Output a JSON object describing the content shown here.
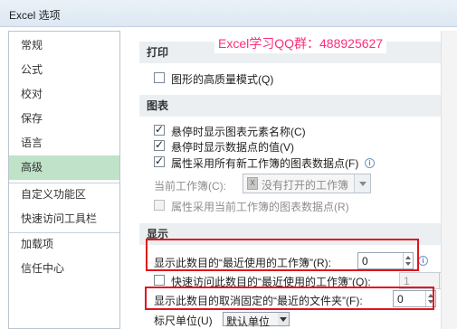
{
  "window": {
    "title": "Excel 选项"
  },
  "watermark": "Excel学习QQ群：488925627",
  "sidebar": {
    "items": [
      {
        "label": "常规"
      },
      {
        "label": "公式"
      },
      {
        "label": "校对"
      },
      {
        "label": "保存"
      },
      {
        "label": "语言"
      },
      {
        "label": "高级",
        "active": true
      },
      {
        "label": "自定义功能区"
      },
      {
        "label": "快速访问工具栏"
      },
      {
        "label": "加载项"
      },
      {
        "label": "信任中心"
      }
    ]
  },
  "sections": {
    "print": {
      "header": "打印",
      "high_quality_graphics": {
        "label": "图形的高质量模式(Q)",
        "checked": false
      }
    },
    "chart": {
      "header": "图表",
      "show_element_names": {
        "label": "悬停时显示图表元素名称(C)",
        "checked": true
      },
      "show_data_values": {
        "label": "悬停时显示数据点的值(V)",
        "checked": true
      },
      "props_follow_all": {
        "label": "属性采用所有新工作簿的图表数据点(F)",
        "checked": true
      },
      "current_workbook_label": "当前工作簿(C):",
      "current_workbook_value": "没有打开的工作簿",
      "props_follow_current": {
        "label": "属性采用当前工作簿的图表数据点(R)",
        "checked": false,
        "disabled": true
      }
    },
    "display": {
      "header": "显示",
      "recent_workbooks_label": "显示此数目的“最近使用的工作簿”(R):",
      "recent_workbooks_value": "0",
      "quick_access_label": "快速访问此数目的“最近使用的工作簿”(Q):",
      "quick_access_value": "1",
      "unpinned_folders_label": "显示此数目的取消固定的“最近的文件夹”(F):",
      "unpinned_folders_value": "0",
      "ruler_units_label": "标尺单位(U)",
      "ruler_units_value": "默认单位"
    }
  },
  "icons": {
    "info": "info-icon",
    "file": "excel-file-icon",
    "dropdown": "chevron-down-icon"
  },
  "colors": {
    "highlight_box": "#e0141e",
    "active_nav": "#bfe2c8",
    "watermark": "#ff2d7a"
  }
}
